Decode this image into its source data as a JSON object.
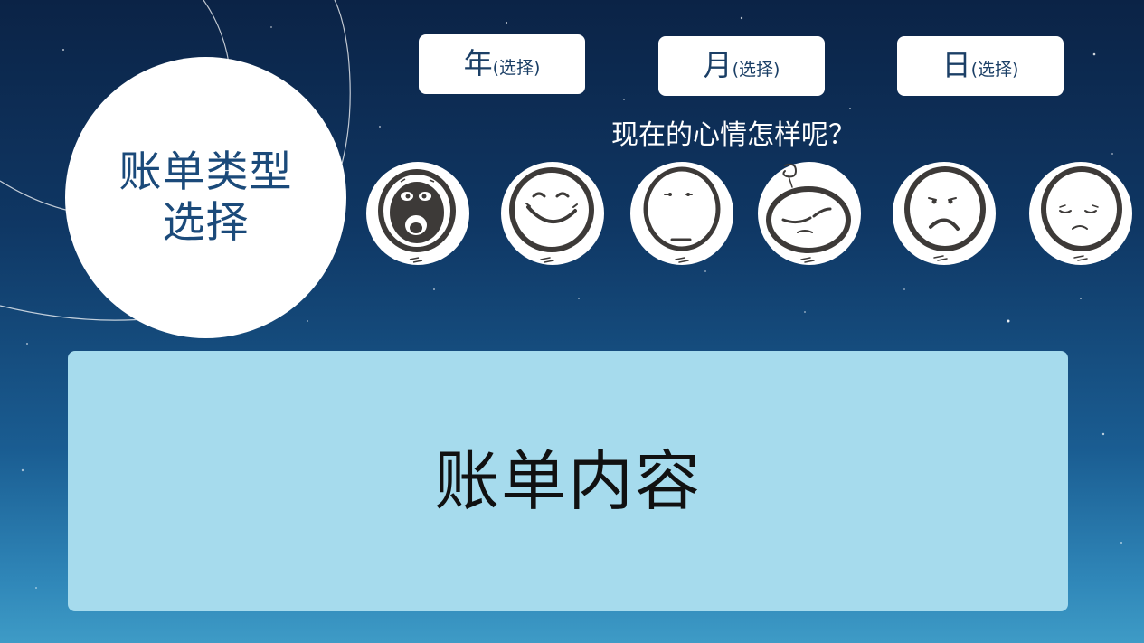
{
  "bill_type": {
    "label": "账单类型选择"
  },
  "date_selectors": {
    "year": {
      "main": "年",
      "sub": "(选择)"
    },
    "month": {
      "main": "月",
      "sub": "(选择)"
    },
    "day": {
      "main": "日",
      "sub": "(选择)"
    }
  },
  "mood": {
    "question": "现在的心情怎样呢？",
    "options": [
      {
        "icon": "laughing-face-icon"
      },
      {
        "icon": "smiling-face-icon"
      },
      {
        "icon": "neutral-face-icon"
      },
      {
        "icon": "dizzy-face-icon"
      },
      {
        "icon": "frowning-face-icon"
      },
      {
        "icon": "sad-face-icon"
      }
    ]
  },
  "content": {
    "title": "账单内容"
  },
  "colors": {
    "panel": "#a6dbed",
    "title_text": "#1b4a7a",
    "background_top": "#0b2346",
    "background_bottom": "#3e9bc6"
  }
}
